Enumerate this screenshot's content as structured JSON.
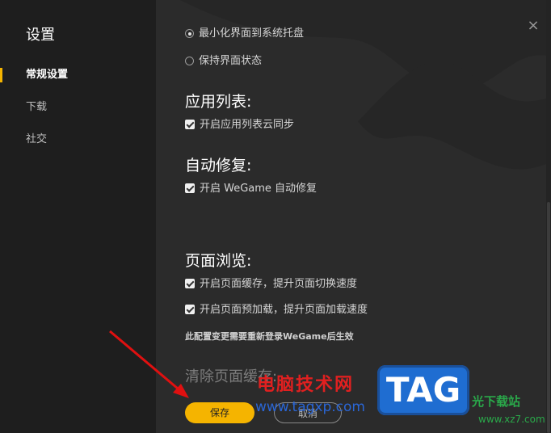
{
  "sidebar": {
    "title": "设置",
    "items": [
      {
        "label": "常规设置",
        "active": true
      },
      {
        "label": "下载",
        "active": false
      },
      {
        "label": "社交",
        "active": false
      }
    ]
  },
  "header": {
    "close_glyph": "×"
  },
  "main": {
    "tray_options": [
      {
        "label": "最小化界面到系统托盘",
        "selected": true
      },
      {
        "label": "保持界面状态",
        "selected": false
      }
    ],
    "app_list": {
      "title": "应用列表:",
      "cloud_sync_label": "开启应用列表云同步",
      "cloud_sync_checked": true
    },
    "auto_repair": {
      "title": "自动修复:",
      "label": "开启 WeGame 自动修复",
      "checked": true
    },
    "page_browse": {
      "title": "页面浏览:",
      "cache_label": "开启页面缓存，提升页面切换速度",
      "cache_checked": true,
      "preload_label": "开启页面预加载，提升页面加载速度",
      "preload_checked": true,
      "note": "此配置变更需要重新登录WeGame后生效"
    },
    "clear_cache": {
      "title": "清除页面缓存:"
    }
  },
  "footer": {
    "save_label": "保存",
    "cancel_label": "取消"
  },
  "watermark": {
    "text": "电脑技术网",
    "url": "www.tagxp.com",
    "badge": "TAG",
    "site": "光下载站",
    "site_url": "www.xz7.com"
  },
  "colors": {
    "accent": "#f5b400",
    "sidebar_bg": "#1e1e1e",
    "content_bg": "#2b2b2b"
  }
}
